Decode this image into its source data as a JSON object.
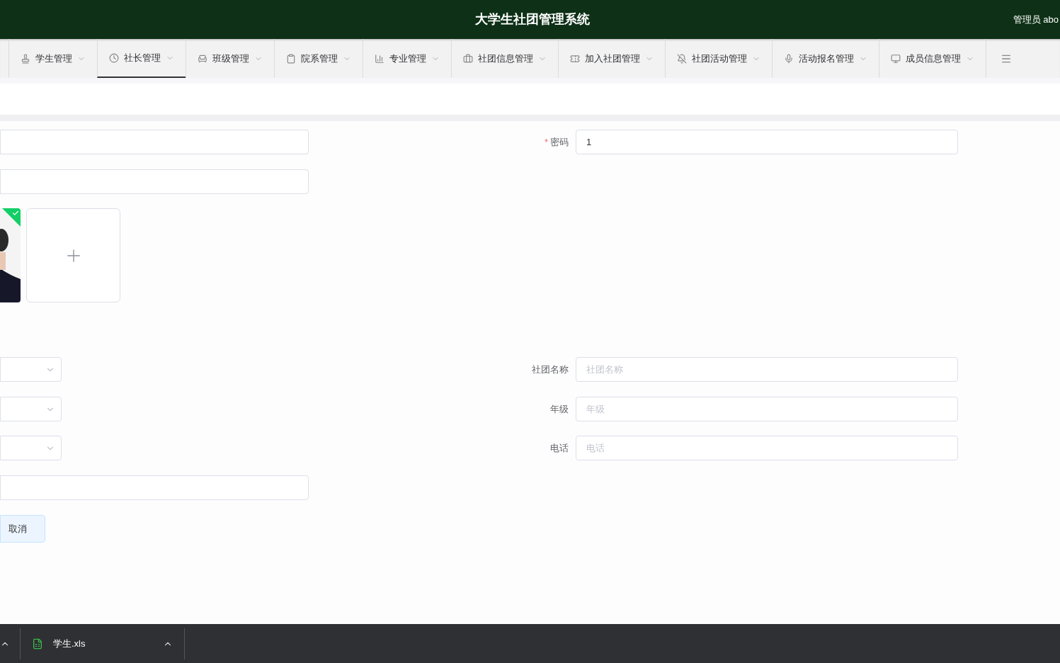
{
  "header": {
    "title": "大学生社团管理系统",
    "user": "管理员 abo"
  },
  "nav": [
    {
      "label": "学生管理",
      "selected": false
    },
    {
      "label": "社长管理",
      "selected": true
    },
    {
      "label": "班级管理",
      "selected": false
    },
    {
      "label": "院系管理",
      "selected": false
    },
    {
      "label": "专业管理",
      "selected": false
    },
    {
      "label": "社团信息管理",
      "selected": false
    },
    {
      "label": "加入社团管理",
      "selected": false
    },
    {
      "label": "社团活动管理",
      "selected": false
    },
    {
      "label": "活动报名管理",
      "selected": false
    },
    {
      "label": "成员信息管理",
      "selected": false
    }
  ],
  "form": {
    "rows": [
      {
        "left": {
          "kind": "input"
        },
        "right": {
          "label": "密码",
          "required_mark": "*",
          "value": "1"
        }
      },
      {
        "left": {
          "kind": "input"
        }
      },
      {
        "left": {
          "kind": "upload",
          "uploaded": true
        }
      },
      {
        "left": {
          "kind": "select"
        },
        "right": {
          "label": "社团名称",
          "placeholder": "社团名称"
        }
      },
      {
        "left": {
          "kind": "select"
        },
        "right": {
          "label": "年级",
          "placeholder": "年级"
        }
      },
      {
        "left": {
          "kind": "select"
        },
        "right": {
          "label": "电话",
          "placeholder": "电话"
        }
      },
      {
        "left": {
          "kind": "input"
        }
      },
      {
        "left": {
          "kind": "button",
          "label": "取消"
        }
      }
    ]
  },
  "taskbar": {
    "downloads": [
      {
        "name": "学生.xls"
      }
    ]
  }
}
